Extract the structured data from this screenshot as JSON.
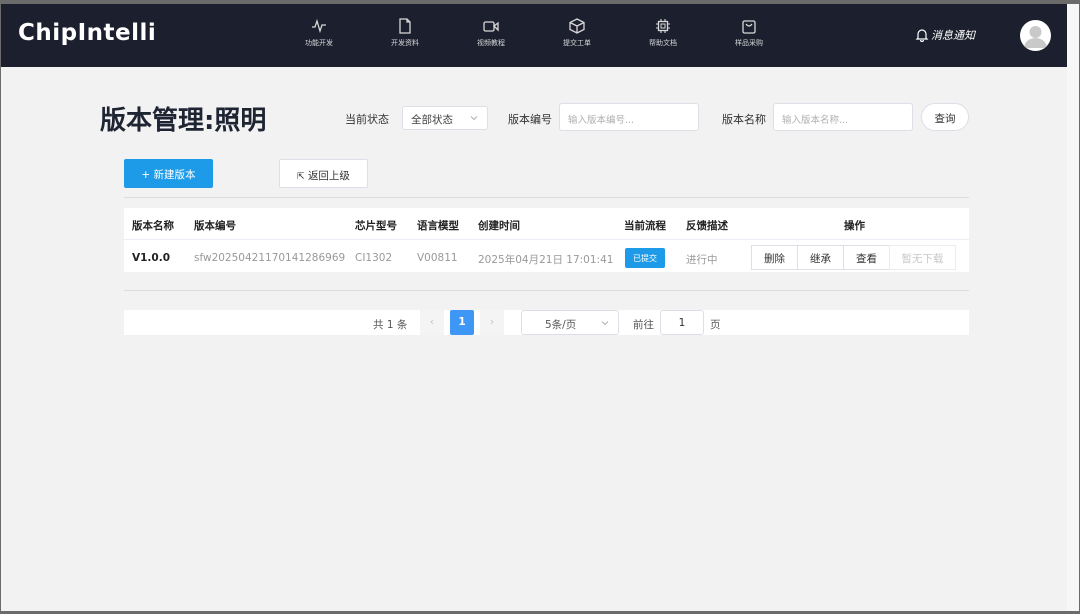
{
  "app": {
    "logo": "ChipIntelli"
  },
  "nav": {
    "items": [
      {
        "label": "功能开发",
        "icon": "activity-icon"
      },
      {
        "label": "开发资料",
        "icon": "document-icon"
      },
      {
        "label": "视频教程",
        "icon": "video-icon"
      },
      {
        "label": "提交工单",
        "icon": "box-icon"
      },
      {
        "label": "帮助文档",
        "icon": "chip-icon"
      },
      {
        "label": "样品采购",
        "icon": "shopping-bag-icon"
      }
    ],
    "notifications": "消息通知"
  },
  "header": {
    "title": "版本管理:照明",
    "status_label": "当前状态",
    "status_value": "全部状态",
    "version_no_label": "版本编号",
    "version_no_placeholder": "输入版本编号...",
    "version_name_label": "版本名称",
    "version_name_placeholder": "输入版本名称...",
    "query_button": "查询"
  },
  "actions": {
    "new_version": "+ 新建版本",
    "back": "返回上级"
  },
  "table": {
    "columns": [
      "版本名称",
      "版本编号",
      "芯片型号",
      "语言模型",
      "创建时间",
      "当前流程",
      "反馈描述",
      "操作"
    ],
    "rows": [
      {
        "name": "V1.0.0",
        "number": "sfw20250421170141286969",
        "chip": "CI1302",
        "model": "V00811",
        "created": "2025年04月21日 17:01:41",
        "flow": "已提交",
        "feedback": "进行中",
        "ops": [
          "删除",
          "继承",
          "查看",
          "暂无下载"
        ]
      }
    ]
  },
  "pagination": {
    "total": "共 1 条",
    "current_page": "1",
    "page_size": "5条/页",
    "goto_label": "前往",
    "goto_value": "1",
    "page_suffix": "页"
  },
  "colors": {
    "navbar": "#1c1f2e",
    "primary": "#1e9be8",
    "page_active": "#3e96f5"
  }
}
